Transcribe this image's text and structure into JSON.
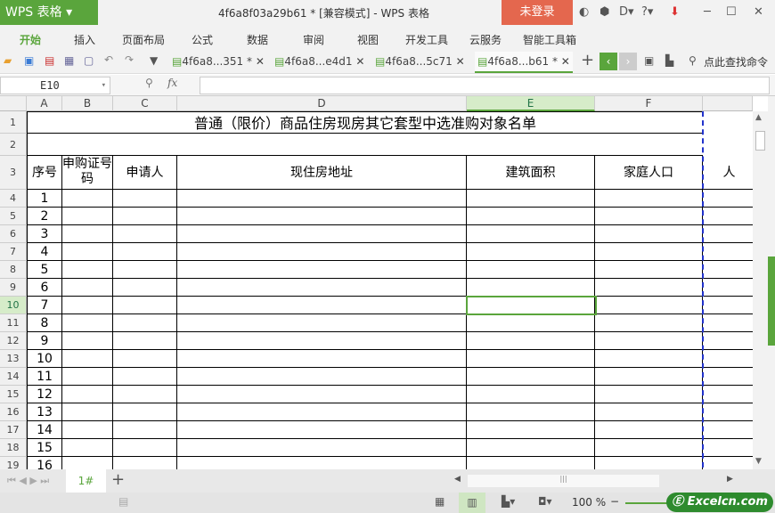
{
  "app": {
    "logo": "WPS 表格",
    "title": "4f6a8f03a29b61 * [兼容模式] - WPS 表格",
    "login": "未登录",
    "controls": [
      "─",
      "☐",
      "✕"
    ]
  },
  "menu": [
    "开始",
    "插入",
    "页面布局",
    "公式",
    "数据",
    "审阅",
    "视图",
    "开发工具",
    "云服务",
    "智能工具箱"
  ],
  "doc_tabs": [
    {
      "label": "4f6a8...351 *"
    },
    {
      "label": "4f6a8...e4d1"
    },
    {
      "label": "4f6a8...5c71"
    },
    {
      "label": "4f6a8...b61 *",
      "active": true
    }
  ],
  "search_label": "点此查找命令",
  "formula": {
    "cell_ref": "E10",
    "fx": "fx",
    "value": ""
  },
  "columns": [
    "A",
    "B",
    "C",
    "D",
    "E",
    "F"
  ],
  "selected_col": "E",
  "selected_row": 10,
  "sheet": {
    "title": "普通（限价）商品住房现房其它套型中选准购对象名单",
    "headers": [
      "序号",
      "申购证号码",
      "申请人",
      "现住房地址",
      "建筑面积",
      "家庭人口",
      "人"
    ],
    "rows": [
      {
        "r": 4,
        "n": "1"
      },
      {
        "r": 5,
        "n": "2"
      },
      {
        "r": 6,
        "n": "3"
      },
      {
        "r": 7,
        "n": "4"
      },
      {
        "r": 8,
        "n": "5"
      },
      {
        "r": 9,
        "n": "6"
      },
      {
        "r": 10,
        "n": "7"
      },
      {
        "r": 11,
        "n": "8"
      },
      {
        "r": 12,
        "n": "9"
      },
      {
        "r": 13,
        "n": "10"
      },
      {
        "r": 14,
        "n": "11"
      },
      {
        "r": 15,
        "n": "12"
      },
      {
        "r": 16,
        "n": "13"
      },
      {
        "r": 17,
        "n": "14"
      },
      {
        "r": 18,
        "n": "15"
      },
      {
        "r": 19,
        "n": "16"
      }
    ]
  },
  "sheet_tabs": [
    "1#"
  ],
  "zoom": "100 %",
  "watermark": "Excelcn.com",
  "accent": "#5aa53c"
}
